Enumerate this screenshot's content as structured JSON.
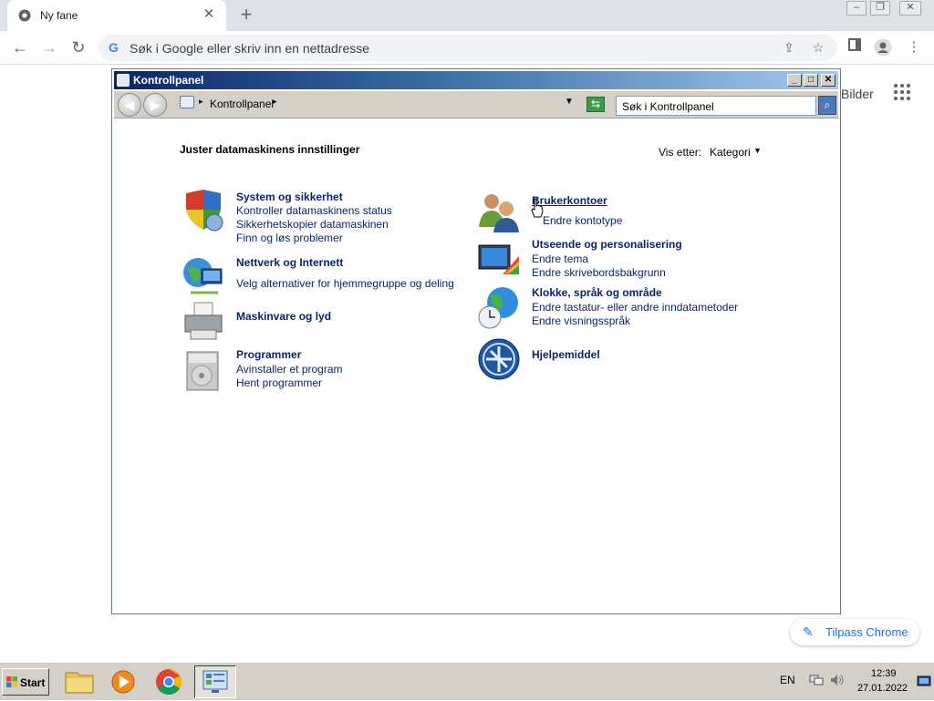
{
  "browser": {
    "tab_title": "Ny fane",
    "address_placeholder": "Søk i Google eller skriv inn en nettadresse",
    "newtab_images_link": "Bilder",
    "customize_label": "Tilpass Chrome"
  },
  "explorer": {
    "window_title": "Kontrollpanel",
    "breadcrumb": "Kontrollpanel",
    "search_placeholder": "Søk i Kontrollpanel",
    "heading": "Juster datamaskinens innstillinger",
    "view_by_label": "Vis etter:",
    "view_by_value": "Kategori",
    "categories_left": [
      {
        "title": "System og sikkerhet",
        "links": [
          "Kontroller datamaskinens status",
          "Sikkerhetskopier datamaskinen",
          "Finn og løs problemer"
        ],
        "icon": "shield-icon"
      },
      {
        "title": "Nettverk og Internett",
        "links": [
          "Velg alternativer for hjemmegruppe og deling"
        ],
        "icon": "network-globe-icon"
      },
      {
        "title": "Maskinvare og lyd",
        "links": [],
        "icon": "printer-icon"
      },
      {
        "title": "Programmer",
        "links": [
          "Avinstaller et program",
          "Hent programmer"
        ],
        "icon": "programs-icon"
      }
    ],
    "categories_right": [
      {
        "title": "Brukerkontoer",
        "links": [
          "Endre kontotype"
        ],
        "icon": "users-icon"
      },
      {
        "title": "Utseende og personalisering",
        "links": [
          "Endre tema",
          "Endre skrivebordsbakgrunn"
        ],
        "icon": "monitor-paint-icon"
      },
      {
        "title": "Klokke, språk og område",
        "links": [
          "Endre tastatur- eller andre inndatametoder",
          "Endre visningsspråk"
        ],
        "icon": "globe-clock-icon"
      },
      {
        "title": "Hjelpemiddel",
        "links": [],
        "icon": "ease-of-access-icon"
      }
    ]
  },
  "taskbar": {
    "start_label": "Start",
    "language": "EN",
    "time": "12:39",
    "date": "27.01.2022"
  }
}
